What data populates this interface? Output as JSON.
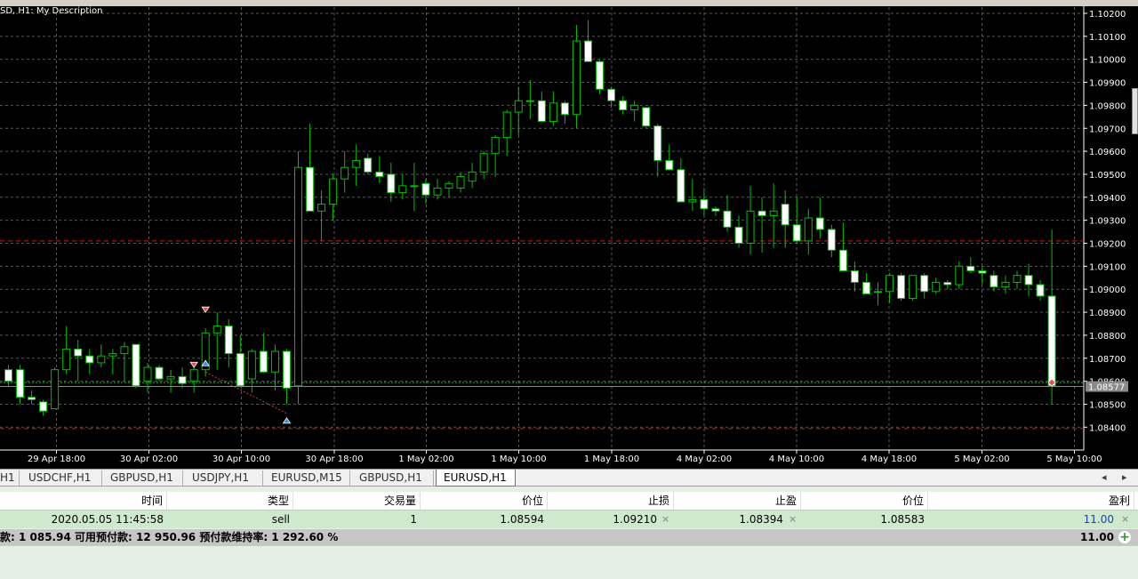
{
  "chart": {
    "description": "SD, H1:  My Description",
    "current_price": "1.08577",
    "price_ticks": [
      "1.10200",
      "1.10100",
      "1.10000",
      "1.09900",
      "1.09800",
      "1.09700",
      "1.09600",
      "1.09500",
      "1.09400",
      "1.09300",
      "1.09200",
      "1.09100",
      "1.09000",
      "1.08900",
      "1.08800",
      "1.08700",
      "1.08600",
      "1.08500",
      "1.08400"
    ],
    "time_ticks": [
      "29 Apr 18:00",
      "30 Apr 02:00",
      "30 Apr 10:00",
      "30 Apr 18:00",
      "1 May 02:00",
      "1 May 10:00",
      "1 May 18:00",
      "4 May 02:00",
      "4 May 10:00",
      "4 May 18:00",
      "5 May 02:00",
      "5 May 10:00"
    ],
    "colors": {
      "background": "#000000",
      "bull": "#00c000",
      "bear_body": "#ffffff",
      "grid": "#5a5a5a",
      "sl_line": "#cc2020",
      "price_line": "#8a8a8a",
      "axis_text": "#ffffff",
      "marker_red": "#e05050",
      "marker_blue": "#3c8de0"
    }
  },
  "chart_data": {
    "type": "candlestick",
    "ylim": [
      1.0833,
      1.1022
    ],
    "lines": {
      "stop_loss": 1.0921,
      "take_profit": 1.08394,
      "current": 1.08577,
      "entry": 1.08594
    },
    "candles": [
      [
        1.0865,
        1.0867,
        1.0858,
        1.086
      ],
      [
        1.0865,
        1.0867,
        1.085,
        1.0853
      ],
      [
        1.0853,
        1.0856,
        1.085,
        1.0852
      ],
      [
        1.0851,
        1.0852,
        1.0845,
        1.0847
      ],
      [
        1.0848,
        1.0866,
        1.0848,
        1.0865
      ],
      [
        1.0865,
        1.0884,
        1.0863,
        1.0874
      ],
      [
        1.0874,
        1.0878,
        1.086,
        1.0871
      ],
      [
        1.0871,
        1.0874,
        1.0863,
        1.0868
      ],
      [
        1.0868,
        1.0876,
        1.0866,
        1.0871
      ],
      [
        1.0871,
        1.0874,
        1.0863,
        1.0872
      ],
      [
        1.0872,
        1.0877,
        1.086,
        1.0875
      ],
      [
        1.0876,
        1.0876,
        1.0857,
        1.0858
      ],
      [
        1.086,
        1.0868,
        1.0855,
        1.0866
      ],
      [
        1.0866,
        1.0867,
        1.086,
        1.0861
      ],
      [
        1.0861,
        1.0865,
        1.0855,
        1.0862
      ],
      [
        1.0862,
        1.0866,
        1.0857,
        1.0859
      ],
      [
        1.086,
        1.0866,
        1.0855,
        1.0865
      ],
      [
        1.0865,
        1.0883,
        1.0862,
        1.0881
      ],
      [
        1.0881,
        1.089,
        1.0865,
        1.0884
      ],
      [
        1.0884,
        1.0887,
        1.0866,
        1.0872
      ],
      [
        1.0872,
        1.088,
        1.0858,
        1.0858
      ],
      [
        1.0861,
        1.0874,
        1.0855,
        1.0873
      ],
      [
        1.0873,
        1.0881,
        1.0864,
        1.0864
      ],
      [
        1.0864,
        1.0876,
        1.0856,
        1.0873
      ],
      [
        1.0873,
        1.0874,
        1.085,
        1.0857
      ],
      [
        1.0858,
        1.096,
        1.085,
        1.0953
      ],
      [
        1.0953,
        1.0972,
        1.0935,
        1.0934
      ],
      [
        1.0934,
        1.0943,
        1.0921,
        1.0937
      ],
      [
        1.0937,
        1.095,
        1.093,
        1.0948
      ],
      [
        1.0948,
        1.096,
        1.0942,
        1.0953
      ],
      [
        1.0953,
        1.0963,
        1.0945,
        1.0956
      ],
      [
        1.0957,
        1.0959,
        1.095,
        1.0951
      ],
      [
        1.0951,
        1.0958,
        1.0946,
        1.0949
      ],
      [
        1.095,
        1.0955,
        1.0938,
        1.0942
      ],
      [
        1.0942,
        1.095,
        1.0939,
        1.0945
      ],
      [
        1.0945,
        1.0955,
        1.0934,
        1.0945
      ],
      [
        1.0946,
        1.0948,
        1.0937,
        1.0941
      ],
      [
        1.0941,
        1.0948,
        1.0939,
        1.0944
      ],
      [
        1.0944,
        1.0947,
        1.094,
        1.0946
      ],
      [
        1.0944,
        1.0951,
        1.0942,
        1.0949
      ],
      [
        1.0947,
        1.0955,
        1.0944,
        1.0951
      ],
      [
        1.0951,
        1.096,
        1.0948,
        1.0959
      ],
      [
        1.0959,
        1.0967,
        1.0949,
        1.0966
      ],
      [
        1.0966,
        1.0978,
        1.0958,
        1.0977
      ],
      [
        1.0977,
        1.0988,
        1.0967,
        1.0982
      ],
      [
        1.0982,
        1.0991,
        1.0974,
        1.0982
      ],
      [
        1.0982,
        1.0986,
        1.0974,
        1.0973
      ],
      [
        1.0973,
        1.0986,
        1.0971,
        1.0981
      ],
      [
        1.0981,
        1.0982,
        1.0972,
        1.0976
      ],
      [
        1.0976,
        1.1015,
        1.097,
        1.1008
      ],
      [
        1.1008,
        1.1017,
        1.1,
        1.0999
      ],
      [
        1.0999,
        1.1,
        1.0985,
        1.0987
      ],
      [
        1.0987,
        1.0988,
        1.0979,
        1.0982
      ],
      [
        1.0982,
        1.0984,
        1.0976,
        1.0978
      ],
      [
        1.0978,
        1.0982,
        1.0973,
        1.098
      ],
      [
        1.0979,
        1.0979,
        1.097,
        1.0971
      ],
      [
        1.0971,
        1.0972,
        1.0949,
        1.0956
      ],
      [
        1.0956,
        1.0963,
        1.0955,
        1.0952
      ],
      [
        1.0952,
        1.0957,
        1.0943,
        1.0938
      ],
      [
        1.0938,
        1.0948,
        1.0934,
        1.0939
      ],
      [
        1.0939,
        1.0944,
        1.0932,
        1.0935
      ],
      [
        1.0935,
        1.0936,
        1.0932,
        1.0934
      ],
      [
        1.0934,
        1.0941,
        1.0925,
        1.0927
      ],
      [
        1.0927,
        1.0932,
        1.0918,
        1.092
      ],
      [
        1.092,
        1.0945,
        1.0915,
        1.0934
      ],
      [
        1.0934,
        1.094,
        1.0916,
        1.0932
      ],
      [
        1.0932,
        1.0946,
        1.0918,
        1.0934
      ],
      [
        1.0937,
        1.0943,
        1.0918,
        1.0928
      ],
      [
        1.0928,
        1.094,
        1.092,
        1.0921
      ],
      [
        1.0921,
        1.0935,
        1.0915,
        1.0931
      ],
      [
        1.0931,
        1.094,
        1.0922,
        1.0926
      ],
      [
        1.0926,
        1.0928,
        1.0914,
        1.0917
      ],
      [
        1.0917,
        1.0929,
        1.0908,
        1.0908
      ],
      [
        1.0908,
        1.0912,
        1.0899,
        1.0903
      ],
      [
        1.0903,
        1.0907,
        1.0898,
        1.0898
      ],
      [
        1.0899,
        1.0903,
        1.0893,
        1.0899
      ],
      [
        1.0899,
        1.0907,
        1.0894,
        1.0906
      ],
      [
        1.0906,
        1.0907,
        1.0895,
        1.0896
      ],
      [
        1.0896,
        1.0905,
        1.0895,
        1.0906
      ],
      [
        1.0906,
        1.0907,
        1.0896,
        1.0899
      ],
      [
        1.0899,
        1.0905,
        1.0898,
        1.0903
      ],
      [
        1.0903,
        1.0904,
        1.09,
        1.0902
      ],
      [
        1.0902,
        1.0912,
        1.09,
        1.091
      ],
      [
        1.091,
        1.0914,
        1.0907,
        1.0908
      ],
      [
        1.0908,
        1.091,
        1.0902,
        1.0907
      ],
      [
        1.0906,
        1.0908,
        1.0899,
        1.0901
      ],
      [
        1.0901,
        1.0906,
        1.0898,
        1.0903
      ],
      [
        1.0903,
        1.0908,
        1.09,
        1.0906
      ],
      [
        1.0906,
        1.0911,
        1.0897,
        1.0902
      ],
      [
        1.0902,
        1.0904,
        1.0895,
        1.0897
      ],
      [
        1.0897,
        1.0926,
        1.085,
        1.0858
      ]
    ],
    "markers": [
      {
        "candle": 17,
        "price": 1.08915,
        "color": "red",
        "shape": "down-arrow"
      },
      {
        "candle": 16,
        "price": 1.08675,
        "color": "red",
        "shape": "down-arrow"
      },
      {
        "candle": 17,
        "price": 1.08675,
        "color": "blue",
        "shape": "up-arrow"
      },
      {
        "candle": 24,
        "price": 1.08425,
        "color": "blue",
        "shape": "up-arrow"
      },
      {
        "candle": 90,
        "price": 1.08594,
        "color": "red",
        "shape": "diamond"
      }
    ]
  },
  "tabs": [
    {
      "label": "H1"
    },
    {
      "label": "USDCHF,H1"
    },
    {
      "label": "GBPUSD,H1"
    },
    {
      "label": "USDJPY,H1"
    },
    {
      "label": "EURUSD,M15"
    },
    {
      "label": "GBPUSD,H1"
    },
    {
      "label": "EURUSD,H1"
    }
  ],
  "tab_scroll": {
    "left": "◂",
    "right": "▸"
  },
  "orders": {
    "headers": {
      "time": "时间",
      "type": "类型",
      "volume": "交易量",
      "price": "价位",
      "sl": "止损",
      "tp": "止盈",
      "current_price": "价位",
      "profit": "盈利"
    },
    "row": {
      "time": "2020.05.05 11:45:58",
      "type": "sell",
      "volume": "1",
      "price": "1.08594",
      "sl": "1.09210",
      "tp": "1.08394",
      "current_price": "1.08583",
      "profit": "11.00",
      "close": "×"
    },
    "summary": "款: 1 085.94  可用预付款: 12 950.96  预付款维持率: 1 292.60 %",
    "total_profit": "11.00",
    "add_label": "+"
  }
}
